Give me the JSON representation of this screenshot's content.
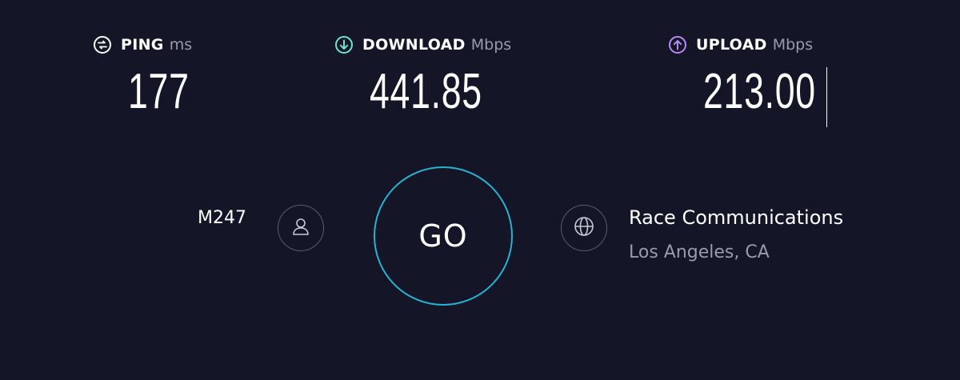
{
  "metrics": {
    "ping": {
      "label": "PING",
      "unit": "ms",
      "value": "177",
      "icon": "ping-icon",
      "color": "#ffffff"
    },
    "download": {
      "label": "DOWNLOAD",
      "unit": "Mbps",
      "value": "441.85",
      "icon": "download-arrow-icon",
      "color": "#6fe3c8"
    },
    "upload": {
      "label": "UPLOAD",
      "unit": "Mbps",
      "value": "213.00",
      "icon": "upload-arrow-icon",
      "color": "#b58cf6"
    }
  },
  "isp": {
    "name": "M247",
    "icon": "user-icon"
  },
  "go_button": {
    "label": "GO",
    "ring_color": "#28b3d1"
  },
  "server": {
    "name": "Race Communications",
    "location": "Los Angeles, CA",
    "icon": "globe-icon"
  },
  "theme": {
    "background": "#141526",
    "muted_text": "#9a9aab",
    "border": "#5a5b6d"
  }
}
